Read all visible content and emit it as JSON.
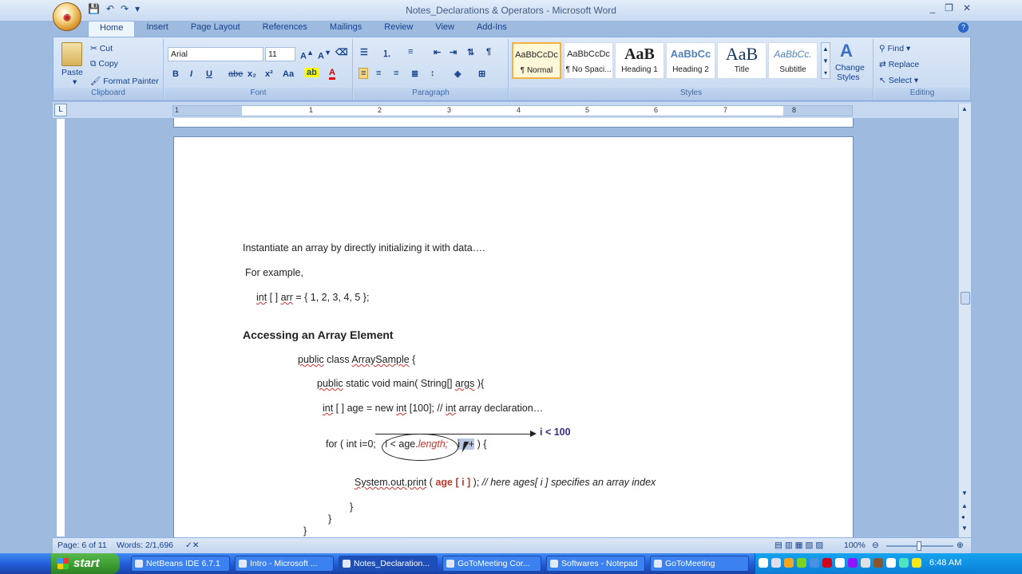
{
  "window": {
    "title": "Notes_Declarations & Operators - Microsoft Word",
    "office_logo": "office-logo",
    "controls": [
      "_",
      "❐",
      "✕"
    ]
  },
  "tabs": [
    "Home",
    "Insert",
    "Page Layout",
    "References",
    "Mailings",
    "Review",
    "View",
    "Add-Ins"
  ],
  "ribbon": {
    "clipboard": {
      "label": "Clipboard",
      "paste": "Paste",
      "cut": "Cut",
      "copy": "Copy",
      "format_painter": "Format Painter"
    },
    "font": {
      "label": "Font",
      "font_name": "Arial",
      "font_size": "11",
      "bold": "B",
      "italic": "I",
      "underline": "U",
      "strikethrough": "abe",
      "subscript": "x₂",
      "superscript": "x²",
      "change_case": "Aa"
    },
    "paragraph": {
      "label": "Paragraph",
      "pilcrow": "¶"
    },
    "styles": {
      "label": "Styles",
      "tiles": [
        {
          "sample": "AaBbCcDc",
          "name": "¶ Normal"
        },
        {
          "sample": "AaBbCcDc",
          "name": "¶ No Spaci..."
        },
        {
          "sample": "AaB",
          "name": "Heading 1"
        },
        {
          "sample": "AaBbCc",
          "name": "Heading 2"
        },
        {
          "sample": "AaB",
          "name": "Title"
        },
        {
          "sample": "AaBbCc.",
          "name": "Subtitle"
        }
      ],
      "change_styles_1": "Change",
      "change_styles_2": "Styles"
    },
    "editing": {
      "label": "Editing",
      "find": "Find",
      "replace": "Replace",
      "select": "Select"
    }
  },
  "ruler": {
    "numbers": [
      "1",
      "1",
      "2",
      "3",
      "4",
      "5",
      "6",
      "7",
      "8"
    ],
    "corner": "L"
  },
  "document": {
    "p1": "Instantiate an array by directly initializing  it with data….",
    "p2": "For example,",
    "p3_a": "int",
    "p3_b": " [ ] ",
    "p3_c": "arr",
    "p3_d": "  =   { 1, 2, 3, 4, 5 };",
    "heading": "Accessing  an Array Element",
    "code1_a": "public",
    "code1_b": " class ",
    "code1_c": "ArraySample",
    "code1_d": " {",
    "code2_a": "public",
    "code2_b": " static void main( String[] ",
    "code2_c": "args",
    "code2_d": " ){",
    "code3_a": "int",
    "code3_b": " [ ] age = new ",
    "code3_c": "int",
    "code3_d": " [100]; //  ",
    "code3_e": "int",
    "code3_f": " array declaration…",
    "code4_a": "for ( int i=0; ",
    "code4_b": "i < age.",
    "code4_c": "length;",
    "code4_d": "i ++",
    "code4_e": " )  {",
    "annotation": "i < 100",
    "code5_a": "System.out.print",
    "code5_b": " ( ",
    "code5_c": "age [ i ]",
    "code5_d": " );    ",
    "code5_e": "//  here ages[ i ] specifies an array index",
    "brace1": "}",
    "brace2": "}",
    "brace3": "}"
  },
  "statusbar": {
    "page": "Page: 6 of 11",
    "words": "Words: 2/1,696",
    "zoom": "100%"
  },
  "taskbar": {
    "start": "start",
    "tasks": [
      "NetBeans IDE 6.7.1",
      "Intro - Microsoft ...",
      "Notes_Declaration...",
      "GoToMeeting Cor...",
      "Softwares - Notepad",
      "GoToMeeting"
    ],
    "clock": "6:48 AM"
  }
}
